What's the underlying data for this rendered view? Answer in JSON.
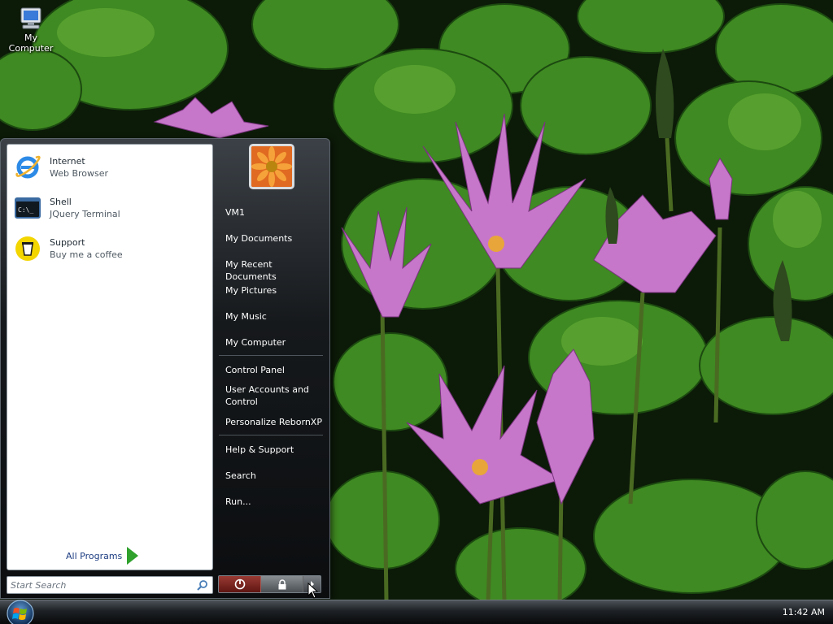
{
  "desktop": {
    "icons": [
      {
        "label": "My Computer",
        "icon": "computer-icon"
      }
    ]
  },
  "start_menu": {
    "pinned": [
      {
        "title": "Internet",
        "subtitle": "Web Browser",
        "icon": "internet-explorer-icon"
      },
      {
        "title": "Shell",
        "subtitle": "JQuery Terminal",
        "icon": "terminal-icon"
      },
      {
        "title": "Support",
        "subtitle": "Buy me a coffee",
        "icon": "coffee-icon"
      }
    ],
    "all_programs": "All Programs",
    "search_placeholder": "Start Search",
    "user_name": "VM1",
    "places": [
      "My Documents",
      "My Recent Documents",
      "My Pictures",
      "My Music",
      "My Computer",
      "Control Panel",
      "User Accounts and Control",
      "Personalize RebornXP",
      "Help & Support",
      "Search",
      "Run..."
    ],
    "power_buttons": [
      "power-icon",
      "lock-icon",
      "arrow-icon"
    ]
  },
  "taskbar": {
    "clock": "11:42 AM"
  },
  "colors": {
    "menu_dark": "#0b0d0f",
    "link_blue": "#1d3d82",
    "accent_green": "#2fa12c"
  }
}
